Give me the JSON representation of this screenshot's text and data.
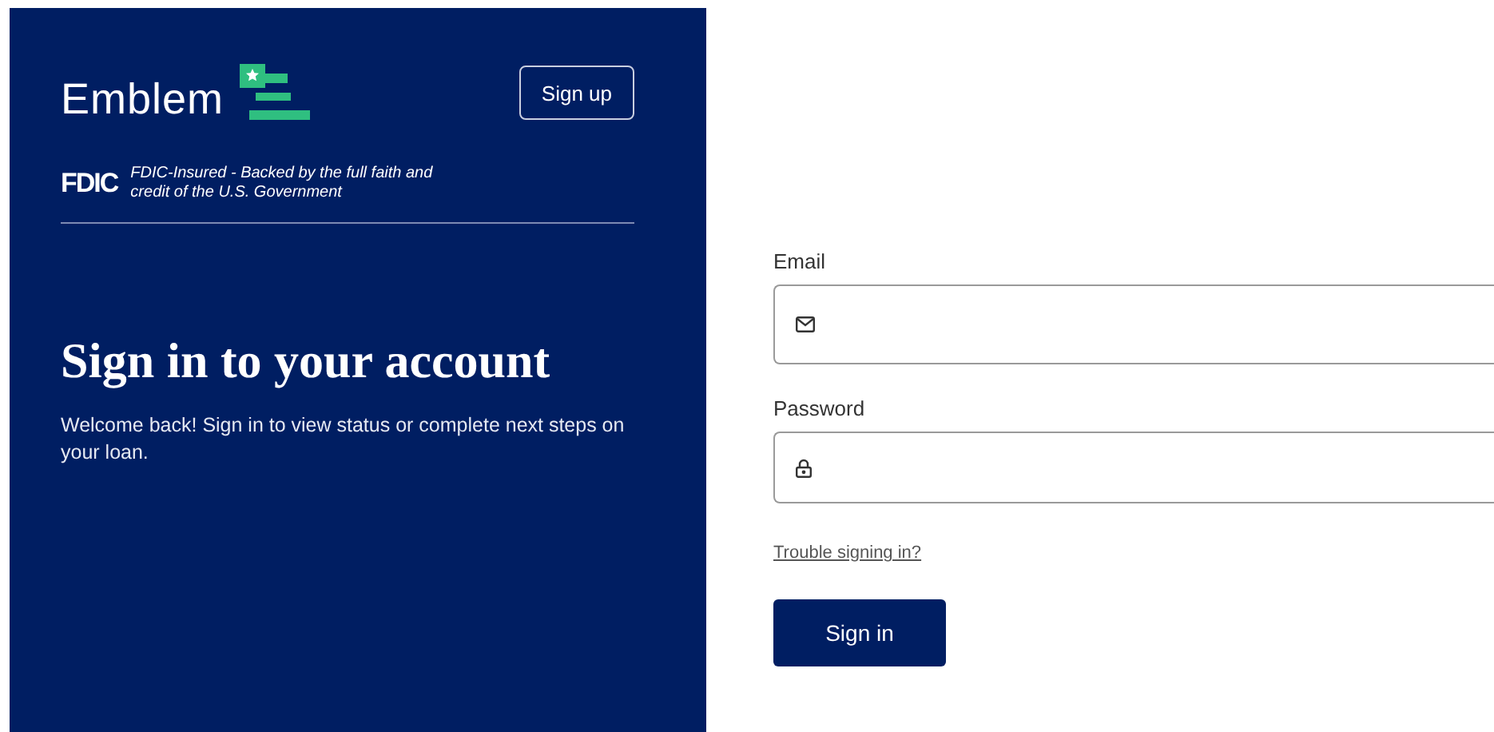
{
  "brand": {
    "name": "Emblem",
    "insurance_badge": "FDIC",
    "insurance_text": "FDIC-Insured - Backed by the full faith and credit of the U.S. Government"
  },
  "signup_button": "Sign up",
  "heading": "Sign in to your account",
  "subtitle": "Welcome back! Sign in to view status or complete next steps on your loan.",
  "fields": [
    {
      "kind": "email",
      "label": "Email"
    },
    {
      "kind": "password",
      "label": "Password"
    }
  ],
  "trouble_link": "Trouble signing in?",
  "submit_button": "Sign in"
}
